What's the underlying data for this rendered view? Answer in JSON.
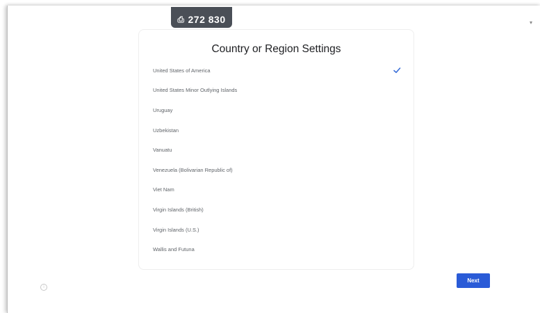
{
  "header": {
    "badge_text": "272 830",
    "badge_icon": "device-icon"
  },
  "card": {
    "title": "Country or Region Settings",
    "items": [
      {
        "label": "United States of America",
        "selected": true
      },
      {
        "label": "United States Minor Outlying Islands",
        "selected": false
      },
      {
        "label": "Uruguay",
        "selected": false
      },
      {
        "label": "Uzbekistan",
        "selected": false
      },
      {
        "label": "Vanuatu",
        "selected": false
      },
      {
        "label": "Venezuela (Bolivarian Republic of)",
        "selected": false
      },
      {
        "label": "Viet Nam",
        "selected": false
      },
      {
        "label": "Virgin Islands (British)",
        "selected": false
      },
      {
        "label": "Virgin Islands (U.S.)",
        "selected": false
      },
      {
        "label": "Wallis and Futuna",
        "selected": false
      }
    ]
  },
  "footer": {
    "next_label": "Next",
    "info_glyph": "i"
  },
  "colors": {
    "accent": "#2a5bd7",
    "check": "#3b6fd8",
    "badge_bg": "#4a4f57",
    "item_text": "#5f6368"
  }
}
